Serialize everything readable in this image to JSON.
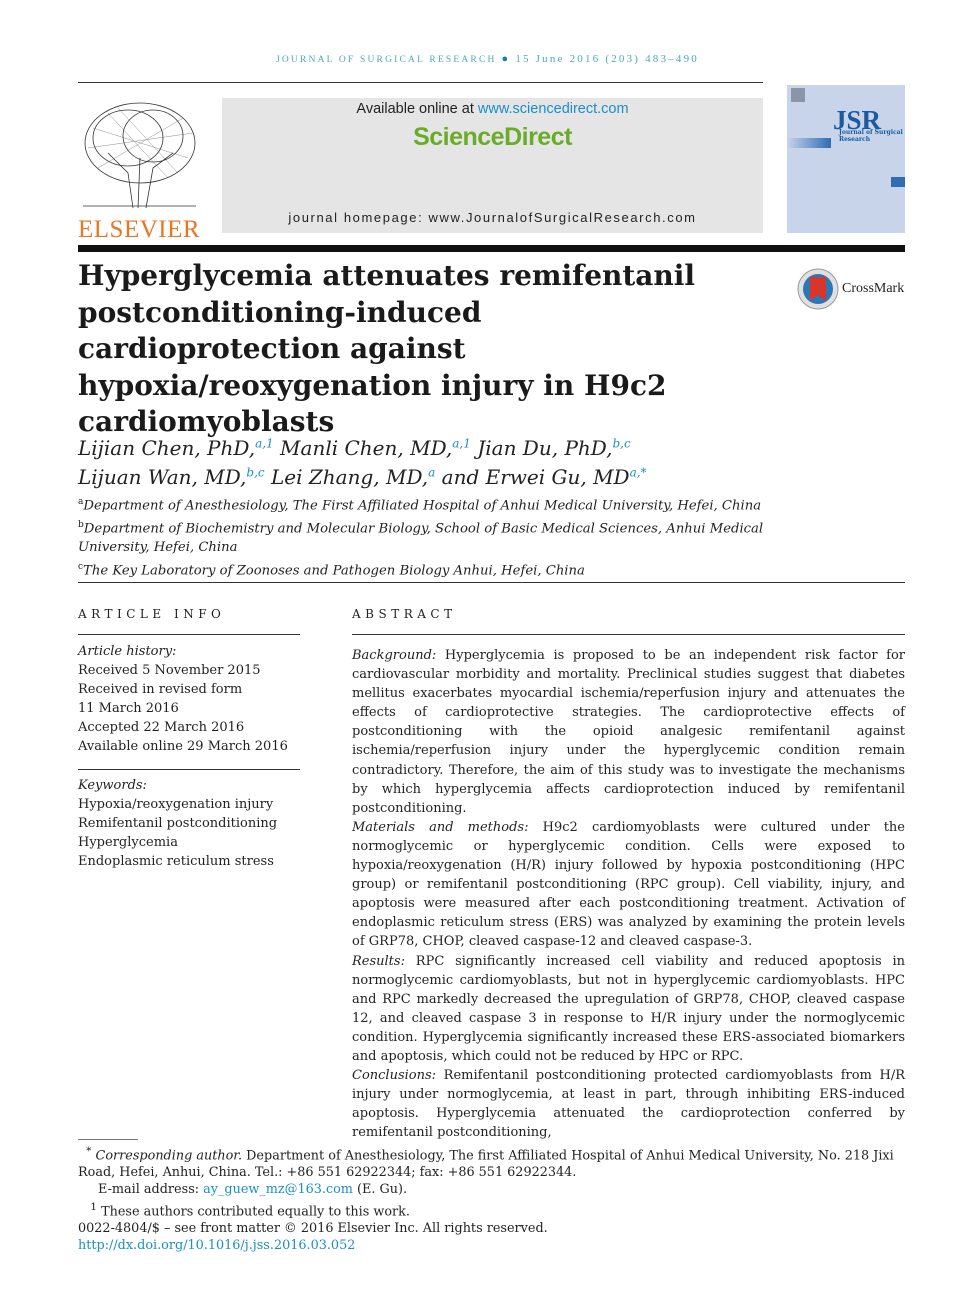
{
  "header": {
    "journal": "Journal of Surgical Research",
    "issue": "15 June 2016 (203) 483–490"
  },
  "banner": {
    "available_online": "Available online at",
    "sd_url": "www.sciencedirect.com",
    "sd_brand": "ScienceDirect",
    "homepage": "journal homepage: www.JournalofSurgicalResearch.com",
    "publisher_logo": "ELSEVIER",
    "cover_logo": "JSR",
    "cover_subtitle": "Journal of Surgical Research",
    "crossmark": "CrossMark"
  },
  "title": "Hyperglycemia attenuates remifentanil postconditioning-induced cardioprotection against hypoxia/reoxygenation injury in H9c2 cardiomyoblasts",
  "authors": [
    {
      "name": "Lijian Chen, PhD,",
      "sup": "a,1"
    },
    {
      "name": "Manli Chen, MD,",
      "sup": "a,1"
    },
    {
      "name": "Jian Du, PhD,",
      "sup": "b,c"
    },
    {
      "name": "Lijuan Wan, MD,",
      "sup": "b,c"
    },
    {
      "name": "Lei Zhang, MD,",
      "sup": "a"
    },
    {
      "name": "and Erwei Gu, MD",
      "sup": "a,*"
    }
  ],
  "affiliations": [
    {
      "mark": "a",
      "text": "Department of Anesthesiology, The First Affiliated Hospital of Anhui Medical University, Hefei, China"
    },
    {
      "mark": "b",
      "text": "Department of Biochemistry and Molecular Biology, School of Basic Medical Sciences, Anhui Medical University, Hefei, China"
    },
    {
      "mark": "c",
      "text": "The Key Laboratory of Zoonoses and Pathogen Biology Anhui, Hefei, China"
    }
  ],
  "article_info": {
    "heading": "ARTICLE INFO",
    "history_label": "Article history:",
    "history": [
      "Received 5 November 2015",
      "Received in revised form",
      "11 March 2016",
      "Accepted 22 March 2016",
      "Available online 29 March 2016"
    ],
    "keywords_label": "Keywords:",
    "keywords": [
      "Hypoxia/reoxygenation injury",
      "Remifentanil postconditioning",
      "Hyperglycemia",
      "Endoplasmic reticulum stress"
    ]
  },
  "abstract": {
    "heading": "ABSTRACT",
    "sections": [
      {
        "label": "Background:",
        "text": "Hyperglycemia is proposed to be an independent risk factor for cardiovascular morbidity and mortality. Preclinical studies suggest that diabetes mellitus exacerbates myocardial ischemia/reperfusion injury and attenuates the effects of cardioprotective strategies. The cardioprotective effects of postconditioning with the opioid analgesic remifentanil against ischemia/reperfusion injury under the hyperglycemic condition remain contradictory. Therefore, the aim of this study was to investigate the mechanisms by which hyperglycemia affects cardioprotection induced by remifentanil postconditioning."
      },
      {
        "label": "Materials and methods:",
        "text": "H9c2 cardiomyoblasts were cultured under the normoglycemic or hyperglycemic condition. Cells were exposed to hypoxia/reoxygenation (H/R) injury followed by hypoxia postconditioning (HPC group) or remifentanil postconditioning (RPC group). Cell viability, injury, and apoptosis were measured after each postconditioning treatment. Activation of endoplasmic reticulum stress (ERS) was analyzed by examining the protein levels of GRP78, CHOP, cleaved caspase-12 and cleaved caspase-3."
      },
      {
        "label": "Results:",
        "text": "RPC significantly increased cell viability and reduced apoptosis in normoglycemic cardiomyoblasts, but not in hyperglycemic cardiomyoblasts. HPC and RPC markedly decreased the upregulation of GRP78, CHOP, cleaved caspase 12, and cleaved caspase 3 in response to H/R injury under the normoglycemic condition. Hyperglycemia significantly increased these ERS-associated biomarkers and apoptosis, which could not be reduced by HPC or RPC."
      },
      {
        "label": "Conclusions:",
        "text": "Remifentanil postconditioning protected cardiomyoblasts from H/R injury under normoglycemia, at least in part, through inhibiting ERS-induced apoptosis. Hyperglycemia attenuated the cardioprotection conferred by remifentanil postconditioning,"
      }
    ]
  },
  "footnotes": {
    "corresponding_mark": "*",
    "corresponding_label": "Corresponding author.",
    "corresponding_text": "Department of Anesthesiology, The first Affiliated Hospital of Anhui Medical University, No. 218 Jixi Road, Hefei, Anhui, China. Tel.: +86 551 62922344; fax: +86 551 62922344.",
    "email_label": "E-mail address:",
    "email": "ay_guew_mz@163.com",
    "email_suffix": "(E. Gu).",
    "equal_mark": "1",
    "equal_text": "These authors contributed equally to this work.",
    "issn": "0022-4804/$ – see front matter © 2016 Elsevier Inc. All rights reserved.",
    "doi": "http://dx.doi.org/10.1016/j.jss.2016.03.052"
  },
  "colors": {
    "link": "#1a8fc6",
    "header": "#4ea6c8",
    "sciencedirect": "#6aab2a",
    "elsevier": "#e87722"
  }
}
